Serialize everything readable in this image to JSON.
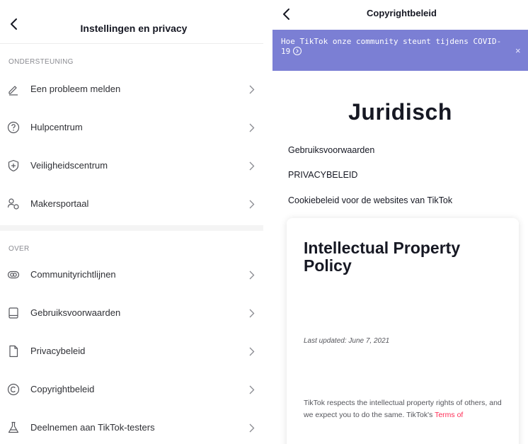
{
  "left": {
    "title": "Instellingen en privacy",
    "sections": [
      {
        "label": "ONDERSTEUNING",
        "items": [
          {
            "label": "Een probleem melden",
            "icon": "pencil-icon"
          },
          {
            "label": "Hulpcentrum",
            "icon": "help-circle-icon"
          },
          {
            "label": "Veiligheidscentrum",
            "icon": "shield-icon"
          },
          {
            "label": "Makersportaal",
            "icon": "creators-icon"
          }
        ]
      },
      {
        "label": "OVER",
        "items": [
          {
            "label": "Communityrichtlijnen",
            "icon": "guidelines-icon"
          },
          {
            "label": "Gebruiksvoorwaarden",
            "icon": "book-icon"
          },
          {
            "label": "Privacybeleid",
            "icon": "document-icon"
          },
          {
            "label": "Copyrightbeleid",
            "icon": "copyright-icon"
          },
          {
            "label": "Deelnemen aan TikTok-testers",
            "icon": "flask-icon"
          }
        ]
      }
    ]
  },
  "right": {
    "title": "Copyrightbeleid",
    "banner": {
      "text": "Hoe TikTok onze community steunt tijdens COVID-19",
      "close": "×",
      "color": "#7b7fd4"
    },
    "heading": "Juridisch",
    "links": [
      "Gebruiksvoorwaarden",
      "PRIVACYBELEID",
      "Cookiebeleid voor de websites van TikTok"
    ],
    "card": {
      "title": "Intellectual Property Policy",
      "updated": "Last updated: June 7, 2021",
      "body": "TikTok respects the intellectual property rights of others, and we expect you to do the same. TikTok's",
      "body_link": "Terms of"
    }
  },
  "colors": {
    "accent": "#fe2c55",
    "text": "#161823",
    "muted": "#8a8b91"
  }
}
